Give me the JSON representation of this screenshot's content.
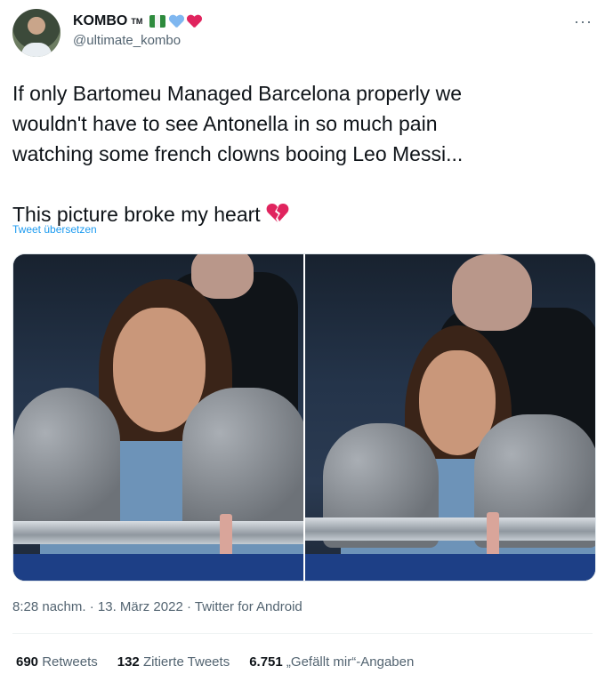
{
  "user": {
    "display_name": "KOMBO",
    "tm": "TM",
    "handle": "@ultimate_kombo",
    "badges": [
      "nigeria-flag-icon",
      "blue-heart-icon",
      "red-heart-icon"
    ]
  },
  "more_icon": "ellipsis-icon",
  "tweet": {
    "line1": "If only Bartomeu Managed Barcelona properly we",
    "line2": "wouldn't have to see Antonella in so much pain",
    "line3": "watching some french clowns booing Leo Messi...",
    "line4": "This picture broke my heart",
    "translate_link": "Tweet übersetzen"
  },
  "meta": {
    "time": "8:28 nachm.",
    "date": "13. März 2022",
    "source": "Twitter for Android"
  },
  "stats": {
    "retweets_count": "690",
    "retweets_label": "Retweets",
    "quotes_count": "132",
    "quotes_label": "Zitierte Tweets",
    "likes_count": "6.751",
    "likes_label": "„Gefällt mir“-Angaben"
  },
  "colors": {
    "link": "#1d9bf0",
    "secondary_text": "#536471",
    "primary_text": "#0f1419",
    "broken_heart": "#e0245e"
  }
}
